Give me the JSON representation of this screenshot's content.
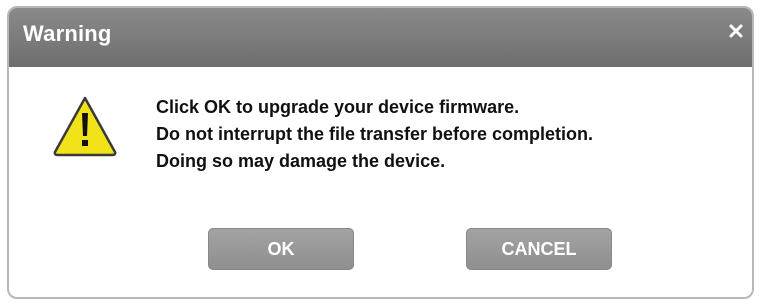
{
  "dialog": {
    "title": "Warning",
    "close_icon": "close-icon",
    "warning_icon": "warning-triangle-icon",
    "message_lines": [
      "Click OK to upgrade your device firmware.",
      "Do not interrupt the file transfer before completion.",
      "Doing so may damage the device."
    ],
    "buttons": {
      "ok_label": "OK",
      "cancel_label": "CANCEL"
    }
  },
  "colors": {
    "titlebar": "#7a7a7a",
    "button": "#999999",
    "warning_fill": "#f2e21a",
    "warning_outline": "#3a3a3a"
  }
}
